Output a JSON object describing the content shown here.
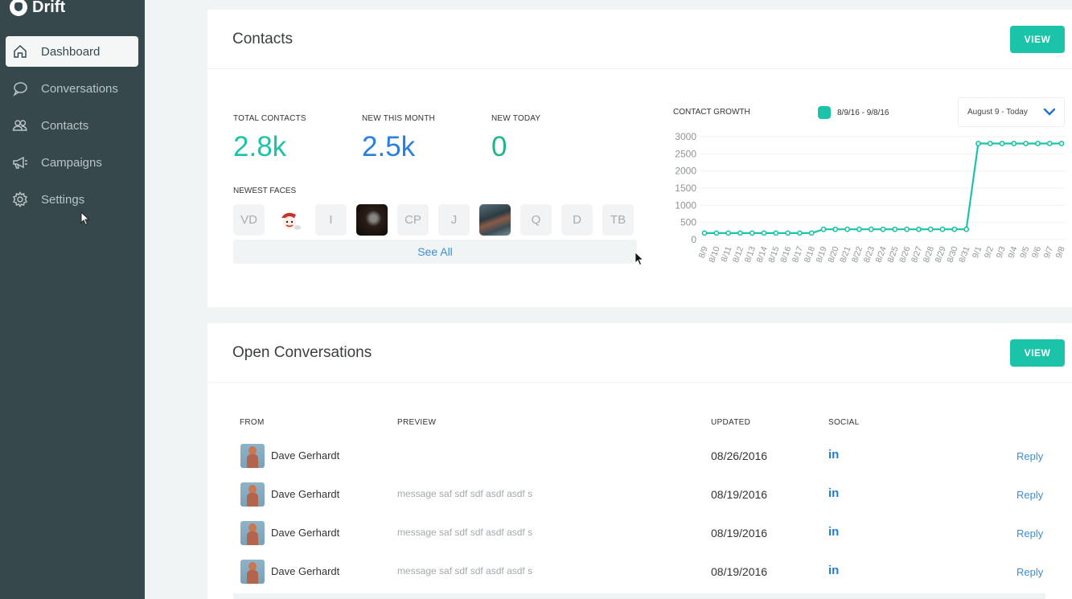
{
  "app": {
    "name": "Drift"
  },
  "sidebar": {
    "items": [
      {
        "label": "Dashboard",
        "icon": "home-icon",
        "active": true
      },
      {
        "label": "Conversations",
        "icon": "chat-bubble-icon",
        "active": false
      },
      {
        "label": "Contacts",
        "icon": "users-icon",
        "active": false
      },
      {
        "label": "Campaigns",
        "icon": "megaphone-icon",
        "active": false
      },
      {
        "label": "Settings",
        "icon": "gear-icon",
        "active": false
      }
    ]
  },
  "contacts_card": {
    "title": "Contacts",
    "view_label": "VIEW",
    "stats": [
      {
        "label": "TOTAL CONTACTS",
        "value": "2.8k",
        "color": "#1bc3a8"
      },
      {
        "label": "NEW THIS MONTH",
        "value": "2.5k",
        "color": "#2a7fe0"
      },
      {
        "label": "NEW TODAY",
        "value": "0",
        "color": "#1fb58c"
      }
    ],
    "newest_faces_label": "NEWEST FACES",
    "faces": [
      {
        "initials": "VD",
        "type": "initials"
      },
      {
        "initials": "",
        "type": "image-santa"
      },
      {
        "initials": "I",
        "type": "initials"
      },
      {
        "initials": "",
        "type": "image-dark"
      },
      {
        "initials": "CP",
        "type": "initials"
      },
      {
        "initials": "J",
        "type": "initials"
      },
      {
        "initials": "",
        "type": "image-car"
      },
      {
        "initials": "Q",
        "type": "initials"
      },
      {
        "initials": "D",
        "type": "initials"
      },
      {
        "initials": "TB",
        "type": "initials"
      }
    ],
    "see_all_label": "See All",
    "growth": {
      "title": "CONTACT GROWTH",
      "legend": "8/9/16 - 9/8/16",
      "date_range_selected": "August 9 - Today"
    }
  },
  "chart_data": {
    "type": "line",
    "title": "CONTACT GROWTH",
    "xlabel": "",
    "ylabel": "",
    "ylim": [
      0,
      3000
    ],
    "yticks": [
      0,
      500,
      1000,
      1500,
      2000,
      2500,
      3000
    ],
    "grid": true,
    "legend_position": "top",
    "color": "#1bc3a8",
    "x": [
      "8/9",
      "8/10",
      "8/11",
      "8/12",
      "8/13",
      "8/14",
      "8/15",
      "8/16",
      "8/17",
      "8/18",
      "8/19",
      "8/20",
      "8/21",
      "8/22",
      "8/23",
      "8/24",
      "8/25",
      "8/26",
      "8/27",
      "8/28",
      "8/29",
      "8/30",
      "8/31",
      "9/1",
      "9/2",
      "9/3",
      "9/4",
      "9/5",
      "9/6",
      "9/7",
      "9/8"
    ],
    "series": [
      {
        "name": "8/9/16 - 9/8/16",
        "values": [
          190,
          190,
          190,
          190,
          190,
          190,
          190,
          190,
          190,
          190,
          300,
          300,
          300,
          300,
          300,
          300,
          300,
          300,
          300,
          300,
          300,
          300,
          300,
          2800,
          2800,
          2800,
          2800,
          2800,
          2800,
          2800,
          2800
        ]
      }
    ]
  },
  "conversations_card": {
    "title": "Open Conversations",
    "view_label": "VIEW",
    "columns": [
      "FROM",
      "PREVIEW",
      "UPDATED",
      "SOCIAL"
    ],
    "rows": [
      {
        "from": "Dave Gerhardt",
        "preview": "",
        "updated": "08/26/2016",
        "social": "in",
        "action": "Reply"
      },
      {
        "from": "Dave Gerhardt",
        "preview": "message saf sdf sdf asdf asdf s",
        "updated": "08/19/2016",
        "social": "in",
        "action": "Reply"
      },
      {
        "from": "Dave Gerhardt",
        "preview": "message saf sdf sdf asdf asdf s",
        "updated": "08/19/2016",
        "social": "in",
        "action": "Reply"
      },
      {
        "from": "Dave Gerhardt",
        "preview": "message saf sdf sdf asdf asdf s",
        "updated": "08/19/2016",
        "social": "in",
        "action": "Reply"
      }
    ]
  }
}
